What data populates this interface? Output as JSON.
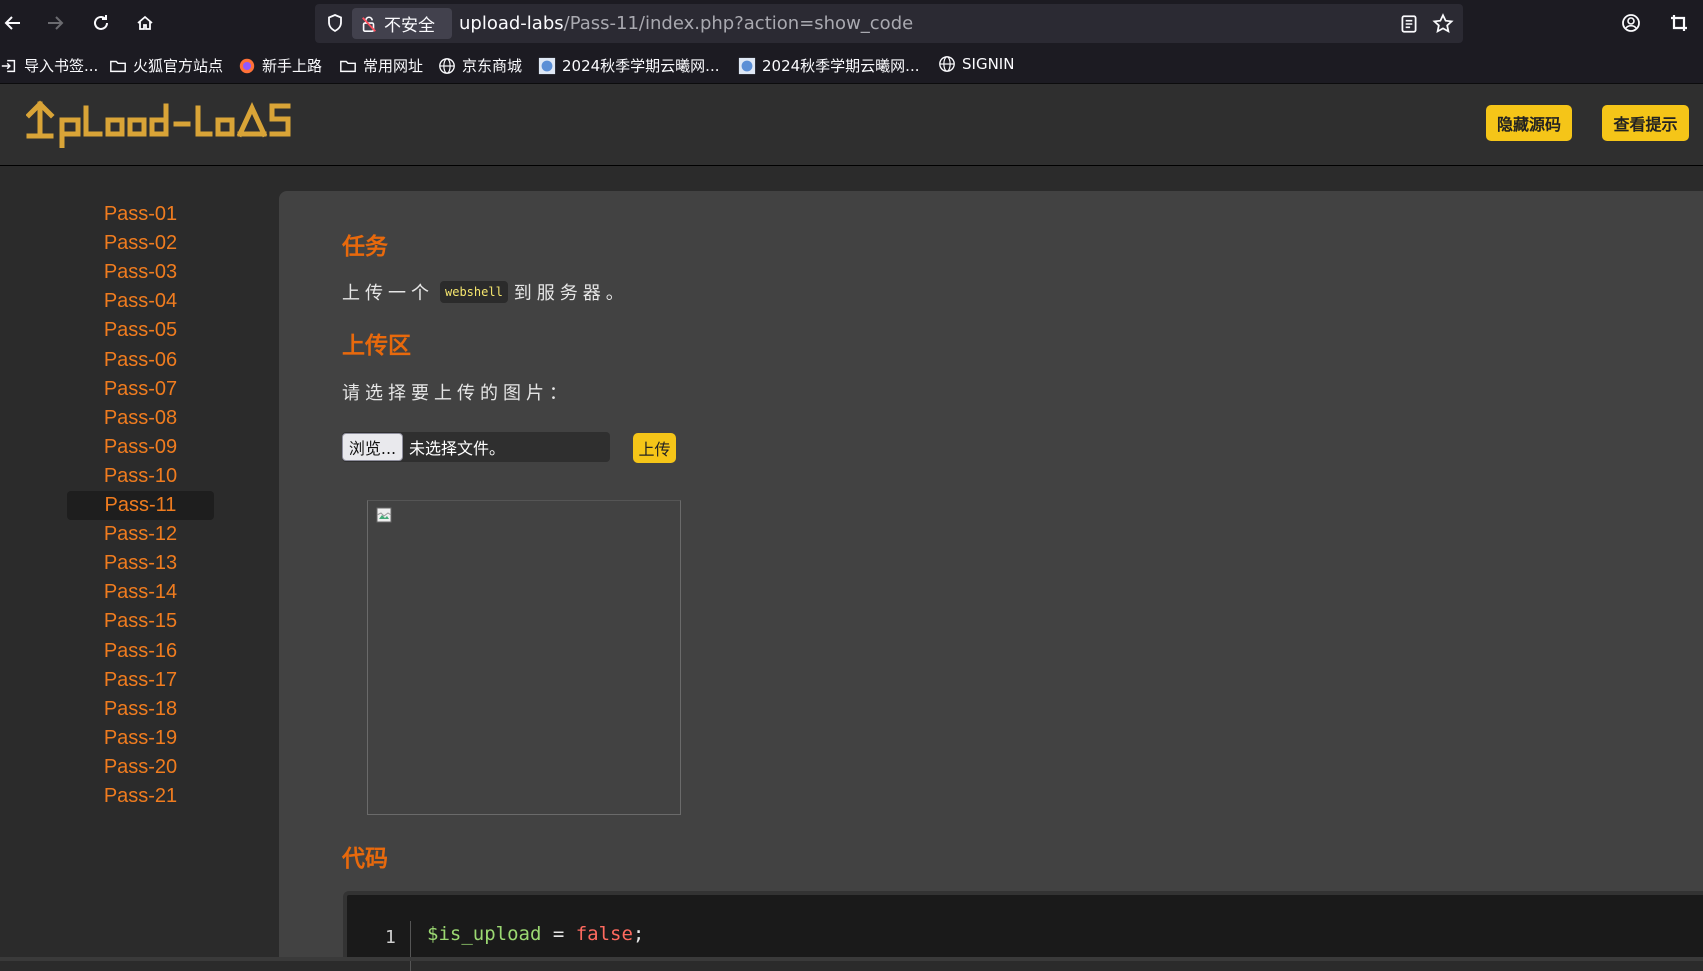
{
  "browser": {
    "security_label": "不安全",
    "url_host": "upload-labs",
    "url_path": "/Pass-11/index.php?action=show_code"
  },
  "bookmarks": [
    {
      "label": "导入书签...",
      "icon": "import-icon"
    },
    {
      "label": "火狐官方站点",
      "icon": "folder-icon"
    },
    {
      "label": "新手上路",
      "icon": "firefox-icon"
    },
    {
      "label": "常用网址",
      "icon": "folder-icon"
    },
    {
      "label": "京东商城",
      "icon": "globe-icon"
    },
    {
      "label": "2024秋季学期云曦网...",
      "icon": "site-favicon"
    },
    {
      "label": "2024秋季学期云曦网...",
      "icon": "site-favicon"
    },
    {
      "label": "SIGNIN",
      "icon": "globe-icon"
    }
  ],
  "header": {
    "logo_text": "Upload-labs",
    "hide_source_label": "隐藏源码",
    "view_hint_label": "查看提示"
  },
  "sidebar": {
    "active": "Pass-11",
    "items": [
      "Pass-01",
      "Pass-02",
      "Pass-03",
      "Pass-04",
      "Pass-05",
      "Pass-06",
      "Pass-07",
      "Pass-08",
      "Pass-09",
      "Pass-10",
      "Pass-11",
      "Pass-12",
      "Pass-13",
      "Pass-14",
      "Pass-15",
      "Pass-16",
      "Pass-17",
      "Pass-18",
      "Pass-19",
      "Pass-20",
      "Pass-21"
    ]
  },
  "task": {
    "heading": "任务",
    "text_before": "上传一个",
    "code": "webshell",
    "text_after": "到服务器。"
  },
  "upload": {
    "heading": "上传区",
    "prompt": "请选择要上传的图片：",
    "browse_label": "浏览...",
    "no_file_label": "未选择文件。",
    "submit_label": "上传"
  },
  "code": {
    "heading": "代码",
    "line_no": "1",
    "var": "$is_upload",
    "op": " = ",
    "value": "false",
    "end": ";"
  },
  "colors": {
    "accent_orange": "#e8690c",
    "button_yellow": "#f5c518",
    "link_orange": "#f07c1f"
  }
}
